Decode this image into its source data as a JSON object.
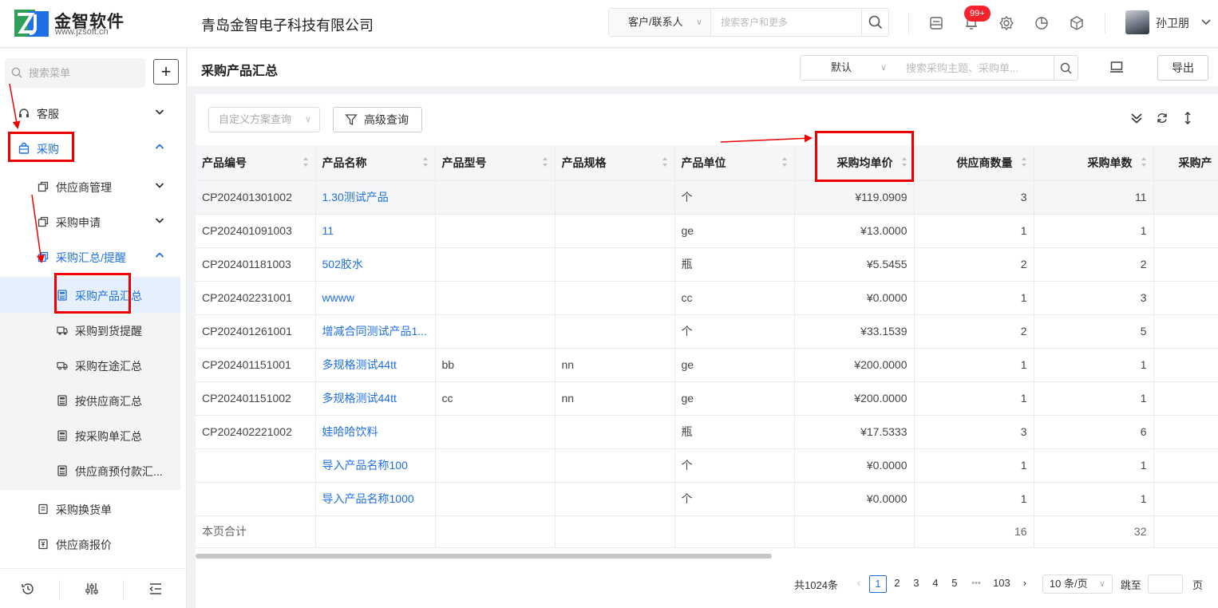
{
  "brand": {
    "name": "金智软件",
    "url": "www.jzsoft.cn",
    "primary_color": "#1f6fe5"
  },
  "header": {
    "company": "青岛金智电子科技有限公司",
    "search_type": "客户/联系人",
    "search_placeholder": "搜索客户和更多",
    "notification_badge": "99+",
    "user_name": "孙卫朋",
    "icons": [
      "inbox-icon",
      "bell-icon",
      "gear-icon",
      "pie-chart-icon",
      "cube-icon"
    ]
  },
  "sidebar": {
    "search_placeholder": "搜索菜单",
    "add_label": "+",
    "items": [
      {
        "label": "客服",
        "level": 1
      },
      {
        "label": "采购",
        "level": 1
      },
      {
        "label": "供应商管理",
        "level": 2
      },
      {
        "label": "采购申请",
        "level": 2
      },
      {
        "label": "采购汇总/提醒",
        "level": 2
      },
      {
        "label": "采购产品汇总",
        "level": 3
      },
      {
        "label": "采购到货提醒",
        "level": 3
      },
      {
        "label": "采购在途汇总",
        "level": 3
      },
      {
        "label": "按供应商汇总",
        "level": 3
      },
      {
        "label": "按采购单汇总",
        "level": 3
      },
      {
        "label": "供应商预付款汇...",
        "level": 3
      },
      {
        "label": "采购换货单",
        "level": 2
      },
      {
        "label": "供应商报价",
        "level": 2
      }
    ],
    "footer_icons": [
      "history-icon",
      "sliders-icon",
      "collapse-menu-icon"
    ]
  },
  "page": {
    "title": "采购产品汇总",
    "view_select": "默认",
    "search_placeholder": "搜索采购主题、采购单...",
    "export_label": "导出",
    "scheme_placeholder": "自定义方案查询",
    "advanced_label": "高级查询"
  },
  "table": {
    "columns": [
      "产品编号",
      "产品名称",
      "产品型号",
      "产品规格",
      "产品单位",
      "采购均单价",
      "供应商数量",
      "采购单数",
      "采购产"
    ],
    "rows": [
      [
        "CP202401301002",
        "1.30测试产品",
        "",
        "",
        "个",
        "¥119.0909",
        "3",
        "11"
      ],
      [
        "CP202401091003",
        "11",
        "",
        "",
        "ge",
        "¥13.0000",
        "1",
        "1"
      ],
      [
        "CP202401181003",
        "502胶水",
        "",
        "",
        "瓶",
        "¥5.5455",
        "2",
        "2"
      ],
      [
        "CP202402231001",
        "wwww",
        "",
        "",
        "cc",
        "¥0.0000",
        "1",
        "3"
      ],
      [
        "CP202401261001",
        "增减合同测试产品1...",
        "",
        "",
        "个",
        "¥33.1539",
        "2",
        "5"
      ],
      [
        "CP202401151001",
        "多规格测试44tt",
        "bb",
        "nn",
        "ge",
        "¥200.0000",
        "1",
        "1"
      ],
      [
        "CP202401151002",
        "多规格测试44tt",
        "cc",
        "nn",
        "ge",
        "¥200.0000",
        "1",
        "1"
      ],
      [
        "CP202402221002",
        "娃哈哈饮料",
        "",
        "",
        "瓶",
        "¥17.5333",
        "3",
        "6"
      ],
      [
        "",
        "导入产品名称100",
        "",
        "",
        "个",
        "¥0.0000",
        "1",
        "1"
      ],
      [
        "",
        "导入产品名称1000",
        "",
        "",
        "个",
        "¥0.0000",
        "1",
        "1"
      ]
    ],
    "total_label": "本页合计",
    "total_supplier_count": "16",
    "total_order_count": "32"
  },
  "pagination": {
    "total": "共1024条",
    "pages": [
      "1",
      "2",
      "3",
      "4",
      "5"
    ],
    "ellipsis": "•••",
    "last_page": "103",
    "current": "1",
    "page_size": "10 条/页",
    "jump_label": "跳至",
    "page_unit": "页"
  },
  "annotation_color": "#e00000"
}
